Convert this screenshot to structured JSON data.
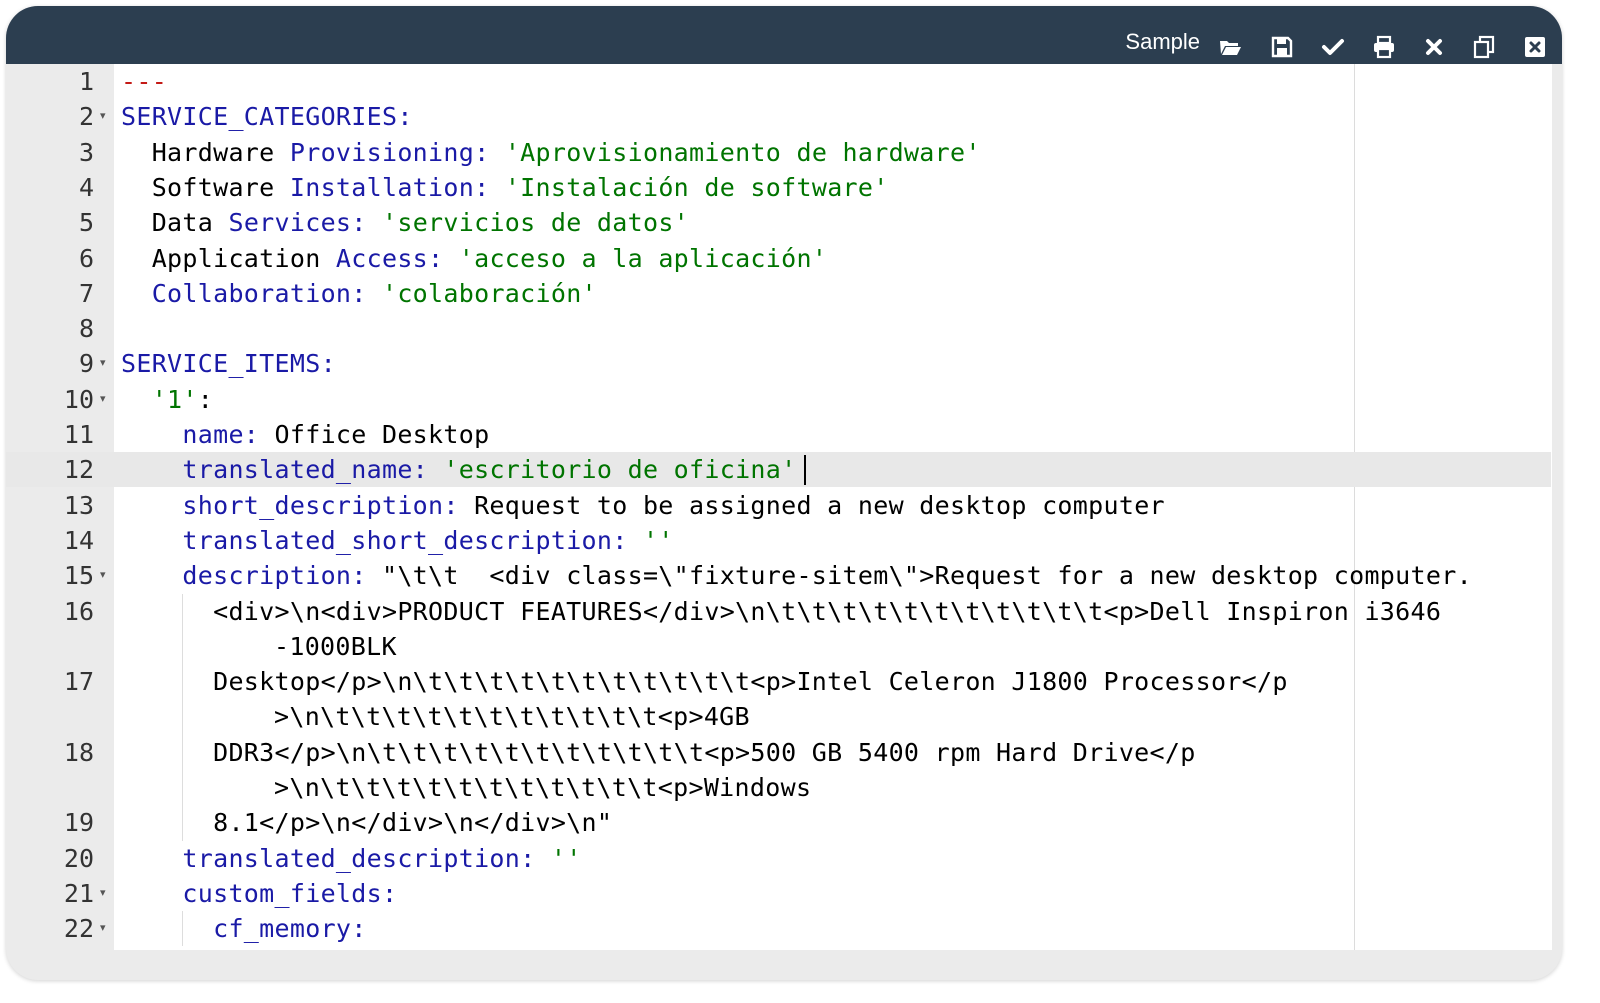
{
  "window": {
    "title": "Sample",
    "accent_color": "#2c3e50",
    "toolbar": [
      {
        "name": "open",
        "icon": "folder-open-icon"
      },
      {
        "name": "save",
        "icon": "floppy-disk-icon"
      },
      {
        "name": "validate",
        "icon": "checkmark-icon"
      },
      {
        "name": "print",
        "icon": "printer-icon"
      },
      {
        "name": "clear",
        "icon": "x-icon"
      },
      {
        "name": "copy",
        "icon": "copy-icon"
      },
      {
        "name": "close",
        "icon": "close-box-icon"
      }
    ]
  },
  "editor": {
    "active_line": 12,
    "lines": [
      {
        "n": "1",
        "fold": false,
        "tokens": [
          {
            "c": "m",
            "t": "---"
          }
        ]
      },
      {
        "n": "2",
        "fold": true,
        "tokens": [
          {
            "c": "k",
            "t": "SERVICE_CATEGORIES:"
          }
        ]
      },
      {
        "n": "3",
        "fold": false,
        "tokens": [
          {
            "c": "p",
            "t": "  Hardware "
          },
          {
            "c": "k",
            "t": "Provisioning:"
          },
          {
            "c": "p",
            "t": " "
          },
          {
            "c": "s",
            "t": "'Aprovisionamiento de hardware'"
          }
        ]
      },
      {
        "n": "4",
        "fold": false,
        "tokens": [
          {
            "c": "p",
            "t": "  Software "
          },
          {
            "c": "k",
            "t": "Installation:"
          },
          {
            "c": "p",
            "t": " "
          },
          {
            "c": "s",
            "t": "'Instalación de software'"
          }
        ]
      },
      {
        "n": "5",
        "fold": false,
        "tokens": [
          {
            "c": "p",
            "t": "  Data "
          },
          {
            "c": "k",
            "t": "Services:"
          },
          {
            "c": "p",
            "t": " "
          },
          {
            "c": "s",
            "t": "'servicios de datos'"
          }
        ]
      },
      {
        "n": "6",
        "fold": false,
        "tokens": [
          {
            "c": "p",
            "t": "  Application "
          },
          {
            "c": "k",
            "t": "Access:"
          },
          {
            "c": "p",
            "t": " "
          },
          {
            "c": "s",
            "t": "'acceso a la aplicación'"
          }
        ]
      },
      {
        "n": "7",
        "fold": false,
        "tokens": [
          {
            "c": "p",
            "t": "  "
          },
          {
            "c": "k",
            "t": "Collaboration:"
          },
          {
            "c": "p",
            "t": " "
          },
          {
            "c": "s",
            "t": "'colaboración'"
          }
        ]
      },
      {
        "n": "8",
        "fold": false,
        "tokens": []
      },
      {
        "n": "9",
        "fold": true,
        "tokens": [
          {
            "c": "k",
            "t": "SERVICE_ITEMS:"
          }
        ]
      },
      {
        "n": "10",
        "fold": true,
        "tokens": [
          {
            "c": "p",
            "t": "  "
          },
          {
            "c": "s",
            "t": "'1'"
          },
          {
            "c": "p",
            "t": ":"
          }
        ]
      },
      {
        "n": "11",
        "fold": false,
        "tokens": [
          {
            "c": "p",
            "t": "    "
          },
          {
            "c": "k",
            "t": "name:"
          },
          {
            "c": "p",
            "t": " Office Desktop"
          }
        ]
      },
      {
        "n": "12",
        "fold": false,
        "tokens": [
          {
            "c": "p",
            "t": "    "
          },
          {
            "c": "k",
            "t": "translated_name:"
          },
          {
            "c": "p",
            "t": " "
          },
          {
            "c": "s",
            "t": "'escritorio de oficina'"
          }
        ]
      },
      {
        "n": "13",
        "fold": false,
        "tokens": [
          {
            "c": "p",
            "t": "    "
          },
          {
            "c": "k",
            "t": "short_description:"
          },
          {
            "c": "p",
            "t": " Request to be assigned a new desktop computer"
          }
        ]
      },
      {
        "n": "14",
        "fold": false,
        "tokens": [
          {
            "c": "p",
            "t": "    "
          },
          {
            "c": "k",
            "t": "translated_short_description:"
          },
          {
            "c": "p",
            "t": " "
          },
          {
            "c": "s",
            "t": "''"
          }
        ]
      },
      {
        "n": "15",
        "fold": true,
        "tokens": [
          {
            "c": "p",
            "t": "    "
          },
          {
            "c": "k",
            "t": "description:"
          },
          {
            "c": "p",
            "t": " \"\\t\\t  <div class=\\\"fixture-sitem\\\">Request for a new desktop computer."
          }
        ]
      },
      {
        "n": "16",
        "fold": false,
        "tokens": [
          {
            "c": "p",
            "t": "      <div>\\n<div>PRODUCT FEATURES</div>\\n\\t\\t\\t\\t\\t\\t\\t\\t\\t\\t\\t<p>Dell Inspiron i3646"
          }
        ],
        "wrap": "-1000BLK"
      },
      {
        "n": "17",
        "fold": false,
        "tokens": [
          {
            "c": "p",
            "t": "      Desktop</p>\\n\\t\\t\\t\\t\\t\\t\\t\\t\\t\\t\\t<p>Intel Celeron J1800 Processor</p"
          }
        ],
        "wrap": ">\\n\\t\\t\\t\\t\\t\\t\\t\\t\\t\\t\\t<p>4GB"
      },
      {
        "n": "18",
        "fold": false,
        "tokens": [
          {
            "c": "p",
            "t": "      DDR3</p>\\n\\t\\t\\t\\t\\t\\t\\t\\t\\t\\t\\t<p>500 GB 5400 rpm Hard Drive</p"
          }
        ],
        "wrap": ">\\n\\t\\t\\t\\t\\t\\t\\t\\t\\t\\t\\t<p>Windows"
      },
      {
        "n": "19",
        "fold": false,
        "tokens": [
          {
            "c": "p",
            "t": "      8.1</p>\\n</div>\\n</div>\\n\""
          }
        ]
      },
      {
        "n": "20",
        "fold": false,
        "tokens": [
          {
            "c": "p",
            "t": "    "
          },
          {
            "c": "k",
            "t": "translated_description:"
          },
          {
            "c": "p",
            "t": " "
          },
          {
            "c": "s",
            "t": "''"
          }
        ]
      },
      {
        "n": "21",
        "fold": true,
        "tokens": [
          {
            "c": "p",
            "t": "    "
          },
          {
            "c": "k",
            "t": "custom_fields:"
          }
        ]
      },
      {
        "n": "22",
        "fold": true,
        "tokens": [
          {
            "c": "p",
            "t": "      "
          },
          {
            "c": "k",
            "t": "cf_memory:"
          }
        ]
      }
    ]
  }
}
